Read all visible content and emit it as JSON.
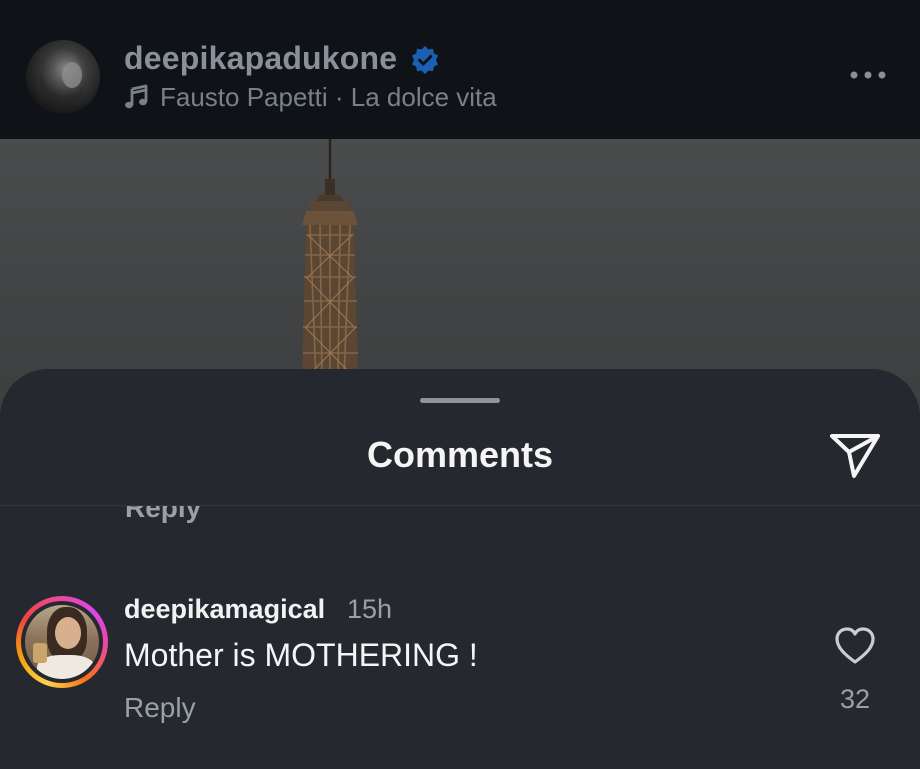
{
  "post_header": {
    "username": "deepikapadukone",
    "music": "Fausto Papetti · La dolce vita"
  },
  "sheet": {
    "title": "Comments",
    "previous_reply_label": "Reply"
  },
  "comment": {
    "username": "deepikamagical",
    "time": "15h",
    "text": "Mother is MOTHERING !",
    "reply_label": "Reply",
    "like_count": "32"
  },
  "icons": {
    "verified": "verified-badge-icon",
    "music": "music-note-icon",
    "more": "more-options-icon",
    "share": "paper-plane-icon",
    "like": "heart-icon"
  },
  "colors": {
    "verified": "#1877f2",
    "sheet_background": "#25282e",
    "story_ring_start": "#fcd34d",
    "story_ring_end": "#ec4899"
  }
}
